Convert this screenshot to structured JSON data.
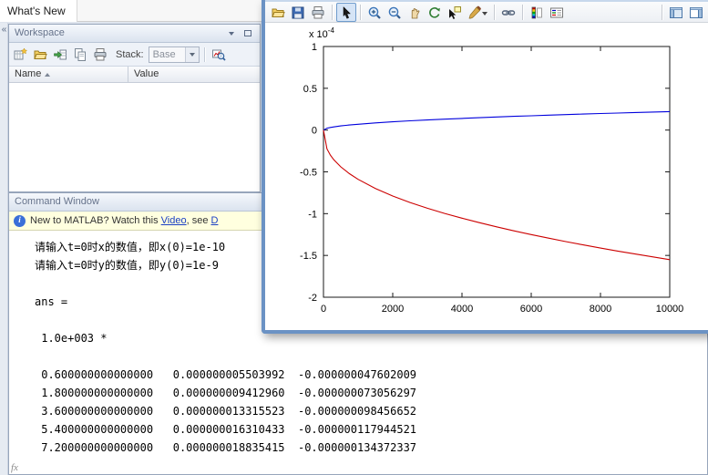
{
  "window": {
    "whats_new_label": "What's New"
  },
  "workspace": {
    "title": "Workspace",
    "toolbar": {
      "icons": [
        "new-variable",
        "open-selection",
        "import-data",
        "copy",
        "print"
      ],
      "stack_label": "Stack:",
      "stack_value": "Base",
      "plot_selector_icon": "plot-selector"
    },
    "columns": [
      {
        "label": "Name",
        "sorted": "asc"
      },
      {
        "label": "Value"
      }
    ],
    "rows": []
  },
  "command_window": {
    "title": "Command Window",
    "banner": {
      "info_icon": "info-icon",
      "text_before": "New to MATLAB? Watch this ",
      "video_link": "Video",
      "text_middle": ", see ",
      "demos_link": "D"
    },
    "prompt_hint": "fx",
    "lines": [
      "请输入t=0时x的数值，即x(0)=1e-10",
      "请输入t=0时y的数值，即y(0)=1e-9",
      "",
      "ans =",
      "",
      " 1.0e+003 *",
      "",
      " 0.600000000000000   0.000000005503992  -0.000000047602009",
      " 1.800000000000000   0.000000009412960  -0.000000073056297",
      " 3.600000000000000   0.000000013315523  -0.000000098456652",
      " 5.400000000000000   0.000000016310433  -0.000000117944521",
      " 7.200000000000000   0.000000018835415  -0.000000134372337"
    ]
  },
  "figure_window": {
    "toolbar_icons": [
      "open",
      "save",
      "print",
      "arrow",
      "zoom-in",
      "zoom-out",
      "pan",
      "rotate-3d",
      "data-cursor",
      "brush",
      "link-plots",
      "insert-colorbar",
      "insert-legend",
      "hide-plot-tools",
      "show-plot-tools"
    ],
    "selected_tool": "arrow"
  },
  "chart_data": {
    "type": "line",
    "title": "",
    "y_scale_prefix": "x 10",
    "y_scale_exponent": "-4",
    "y_unit_multiplier": "1e-4",
    "xlim": [
      0,
      10000
    ],
    "ylim": [
      -2,
      1
    ],
    "x_ticks": [
      0,
      2000,
      4000,
      6000,
      8000,
      10000
    ],
    "y_ticks": [
      1,
      0.5,
      0,
      -0.5,
      -1,
      -1.5,
      -2
    ],
    "grid": false,
    "legend": "none",
    "series": [
      {
        "name": "blue-curve",
        "color": "#0000DD",
        "x": [
          0,
          100,
          200,
          300,
          500,
          750,
          1000,
          1500,
          2000,
          2500,
          3000,
          3500,
          4000,
          4500,
          5000,
          5500,
          6000,
          6500,
          7000,
          7500,
          8000,
          8500,
          9000,
          9500,
          10000
        ],
        "y": [
          0,
          0.0221,
          0.0313,
          0.0383,
          0.0494,
          0.0605,
          0.0699,
          0.0856,
          0.0988,
          0.1105,
          0.121,
          0.1307,
          0.1398,
          0.1482,
          0.1563,
          0.1639,
          0.1712,
          0.1782,
          0.1849,
          0.1914,
          0.1977,
          0.2038,
          0.2097,
          0.2154,
          0.221
        ]
      },
      {
        "name": "red-curve",
        "color": "#CC0000",
        "x": [
          0,
          100,
          200,
          300,
          500,
          750,
          1000,
          1500,
          2000,
          2500,
          3000,
          3500,
          4000,
          4500,
          5000,
          5500,
          6000,
          6500,
          7000,
          7500,
          8000,
          8500,
          9000,
          9500,
          10000
        ],
        "y": [
          0,
          -0.224,
          -0.3,
          -0.356,
          -0.44,
          -0.522,
          -0.589,
          -0.699,
          -0.789,
          -0.866,
          -0.935,
          -0.997,
          -1.054,
          -1.108,
          -1.158,
          -1.206,
          -1.251,
          -1.293,
          -1.334,
          -1.374,
          -1.412,
          -1.448,
          -1.483,
          -1.517,
          -1.55
        ]
      }
    ]
  }
}
